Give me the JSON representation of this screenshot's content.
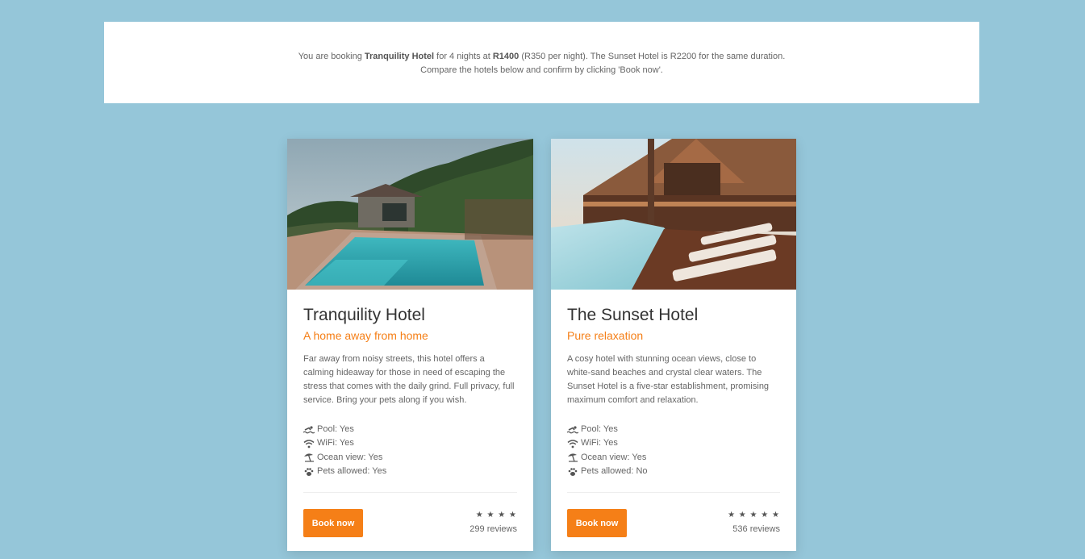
{
  "banner": {
    "line1_prefix": "You are booking ",
    "hotel": "Tranquility Hotel",
    "line1_mid": " for 4 nights at ",
    "price": "R1400",
    "line1_suffix": " (R350 per night). The Sunset Hotel is R2200 for the same duration.",
    "line2": "Compare the hotels below and confirm by clicking 'Book now'."
  },
  "hotels": [
    {
      "name": "Tranquility Hotel",
      "tagline": "A home away from home",
      "description": "Far away from noisy streets, this hotel offers a calming hideaway for those in need of escaping the stress that comes with the daily grind. Full privacy, full service. Bring your pets along if you wish.",
      "amenities": {
        "pool": "Pool: Yes",
        "wifi": "WiFi: Yes",
        "ocean": "Ocean view: Yes",
        "pets": "Pets allowed: Yes"
      },
      "book_label": "Book now",
      "stars": "★ ★ ★ ★",
      "rating": 4,
      "reviews": "299 reviews"
    },
    {
      "name": "The Sunset Hotel",
      "tagline": "Pure relaxation",
      "description": "A cosy hotel with stunning ocean views, close to white-sand beaches and crystal clear waters. The Sunset Hotel is a five-star establishment, promising maximum comfort and relaxation.",
      "amenities": {
        "pool": "Pool: Yes",
        "wifi": "WiFi: Yes",
        "ocean": "Ocean view: Yes",
        "pets": "Pets allowed: No"
      },
      "book_label": "Book now",
      "stars": "★ ★ ★ ★ ★",
      "rating": 5,
      "reviews": "536 reviews"
    }
  ],
  "colors": {
    "background": "#95c6d9",
    "accent": "#f57f17",
    "card": "#ffffff"
  },
  "icons": [
    "swimmer-icon",
    "wifi-icon",
    "umbrella-beach-icon",
    "paw-icon"
  ]
}
